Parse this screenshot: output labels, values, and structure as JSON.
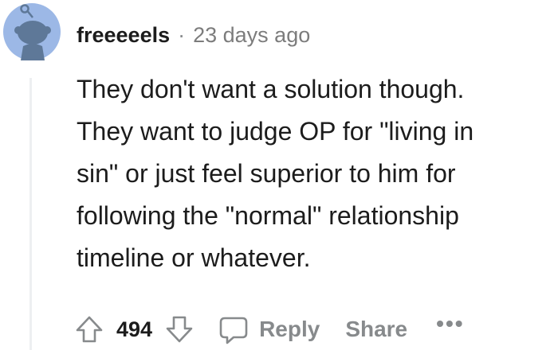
{
  "comment": {
    "username": "freeeeels",
    "separator": "·",
    "timestamp": "23 days ago",
    "body_lines": [
      "They don't want a solution though.",
      "They want to judge OP for \"living in",
      "sin\" or just feel superior to him for",
      "following the \"normal\" relationship",
      "timeline or whatever."
    ]
  },
  "actions": {
    "vote_count": "494",
    "reply_label": "Reply",
    "share_label": "Share",
    "more_label": "•••"
  },
  "colors": {
    "avatar_bg": "#9cb8e6",
    "avatar_figure": "#5e7898",
    "text": "#1c1c1c",
    "muted": "#878a8c",
    "thread_line": "#edeff1"
  }
}
